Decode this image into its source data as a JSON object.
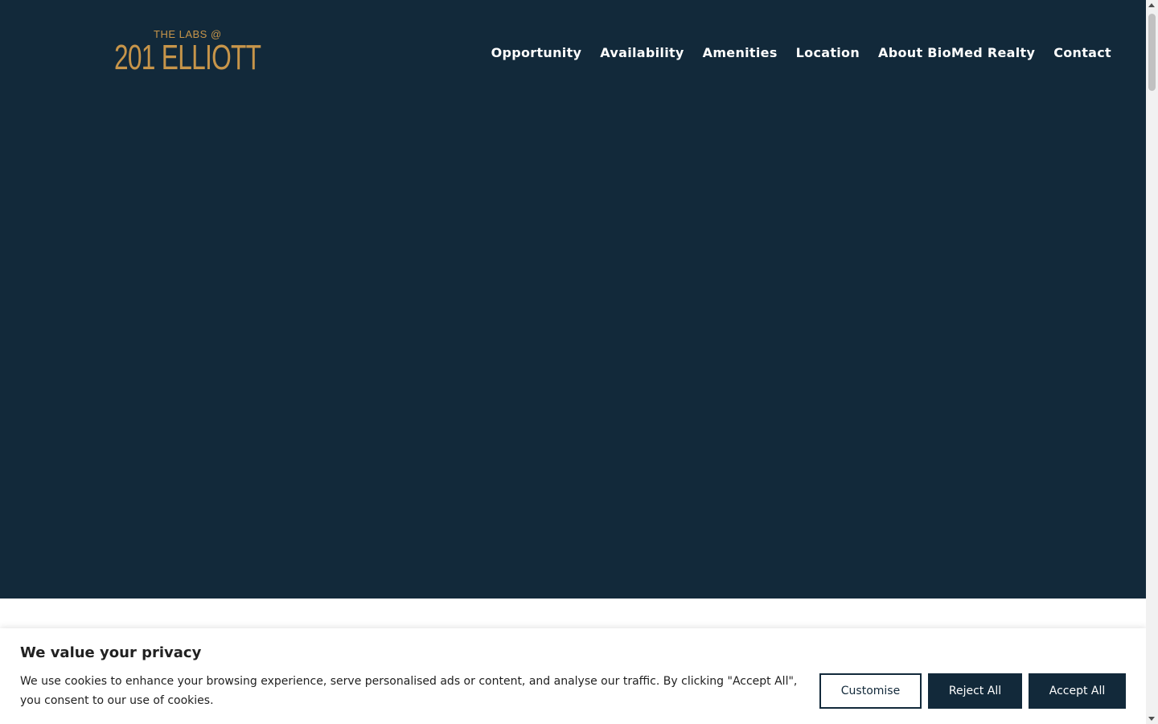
{
  "brand": {
    "logo_top": "THE LABS @",
    "logo_main": "201 ELLIOTT",
    "accent_color": "#c7954a"
  },
  "nav": {
    "items": [
      {
        "label": "Opportunity"
      },
      {
        "label": "Availability"
      },
      {
        "label": "Amenities"
      },
      {
        "label": "Location"
      },
      {
        "label": "About BioMed Realty"
      },
      {
        "label": "Contact"
      }
    ]
  },
  "hero": {
    "background_color": "#12293a"
  },
  "cookie_banner": {
    "title": "We value your privacy",
    "text": "We use cookies to enhance your browsing experience, serve personalised ads or content, and analyse our traffic. By clicking \"Accept All\", you consent to our use of cookies.",
    "customise_label": "Customise",
    "reject_label": "Reject All",
    "accept_label": "Accept All"
  }
}
